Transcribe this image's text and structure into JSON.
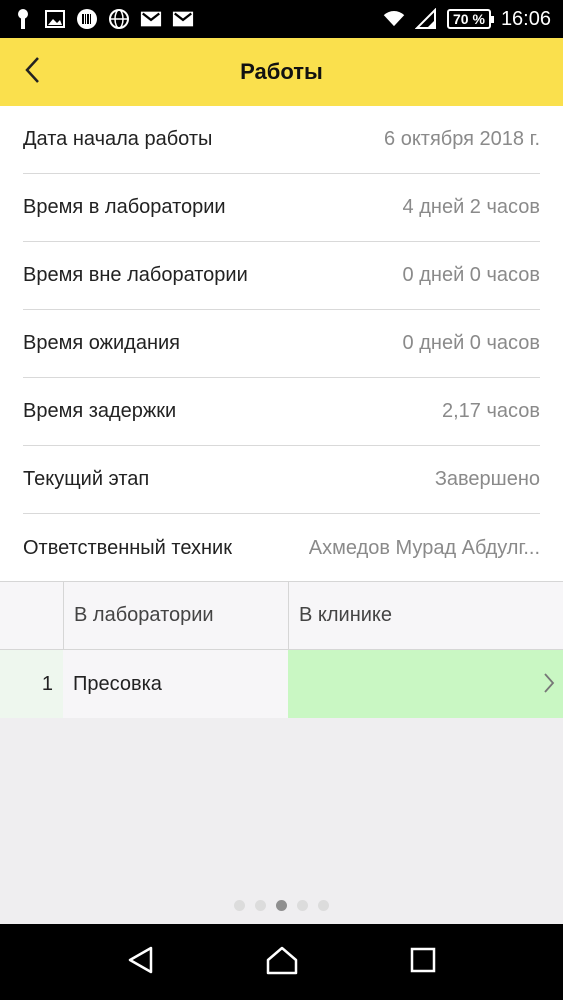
{
  "status_bar": {
    "battery": "70 %",
    "time": "16:06",
    "icons": [
      "key-icon",
      "image-icon",
      "barcode-icon",
      "globe-icon",
      "mail-icon",
      "mail-icon",
      "wifi-icon",
      "signal-icon"
    ]
  },
  "app_bar": {
    "title": "Работы",
    "back_icon": "chevron-left-icon",
    "color": "#fae04d"
  },
  "details": [
    {
      "label": "Дата начала работы",
      "value": "6 октября 2018 г."
    },
    {
      "label": "Время в лаборатории",
      "value": "4 дней 2 часов"
    },
    {
      "label": "Время вне лаборатории",
      "value": "0 дней 0 часов"
    },
    {
      "label": "Время ожидания",
      "value": "0 дней 0 часов"
    },
    {
      "label": "Время задержки",
      "value": "2,17 часов"
    },
    {
      "label": "Текущий этап",
      "value": "Завершено"
    },
    {
      "label": "Ответственный техник",
      "value": "Ахмедов Мурад Абдулг..."
    }
  ],
  "table": {
    "headers": [
      "",
      "В лаборатории",
      "В клинике"
    ],
    "rows": [
      {
        "num": "1",
        "lab": "Пресовка",
        "clinic": ""
      }
    ],
    "clinic_highlight": "#c9f7c3"
  },
  "pager": {
    "count": 5,
    "active": 3
  },
  "nav_bar": {
    "icons": [
      "back-triangle-icon",
      "home-icon",
      "recents-square-icon"
    ]
  }
}
